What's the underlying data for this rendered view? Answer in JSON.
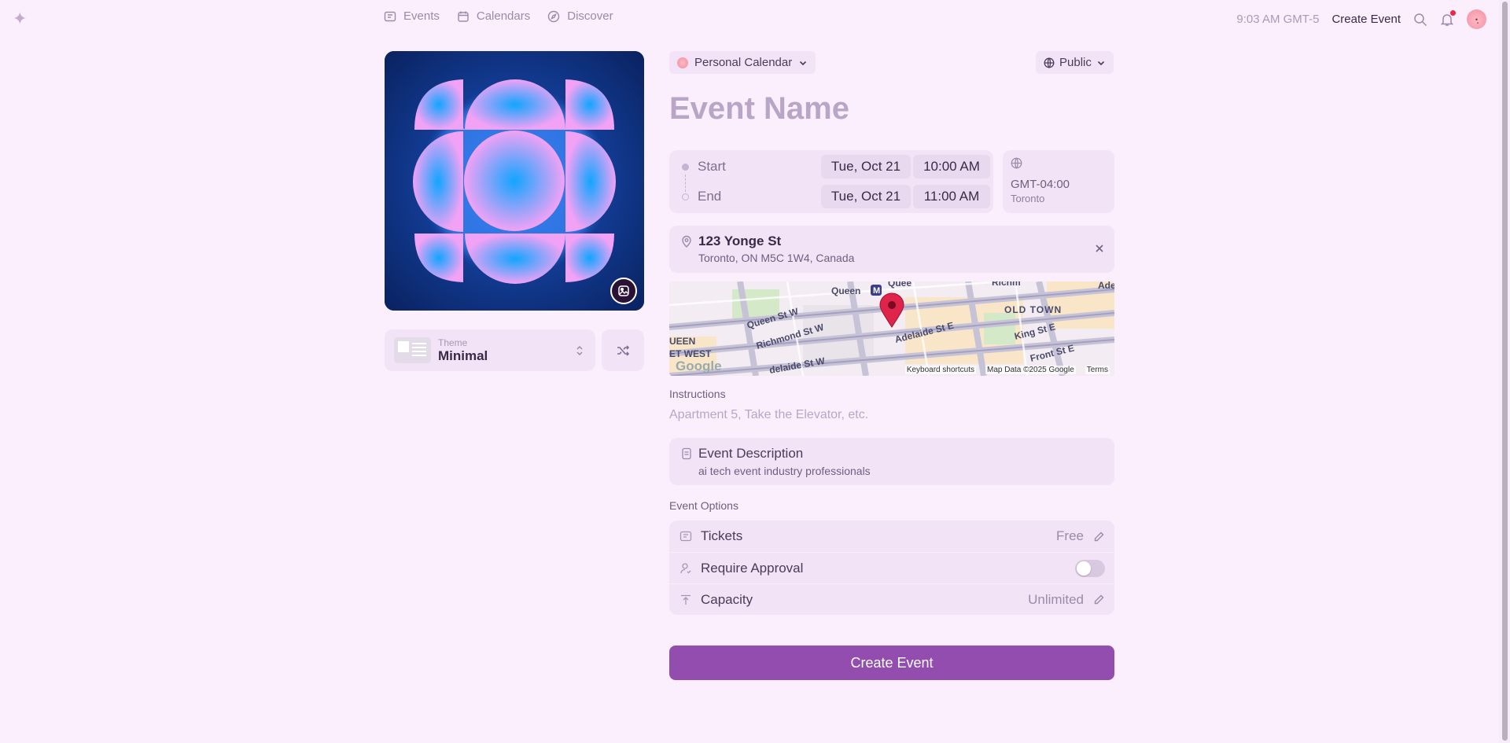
{
  "nav": {
    "logo_icon": "sparkle-icon",
    "items": [
      {
        "label": "Events",
        "icon": "ticket-icon"
      },
      {
        "label": "Calendars",
        "icon": "calendar-icon"
      },
      {
        "label": "Discover",
        "icon": "compass-icon"
      }
    ],
    "time": "9:03 AM GMT-5",
    "create_event": "Create Event",
    "notification_color": "#e8294a"
  },
  "cover": {
    "colors": {
      "background": "#0b2a6a",
      "pink": "#f2a2f5",
      "cyan": "#12a5ff"
    }
  },
  "theme": {
    "label": "Theme",
    "value": "Minimal"
  },
  "calendar": {
    "label": "Personal Calendar"
  },
  "visibility": {
    "label": "Public"
  },
  "event_name": {
    "placeholder": "Event Name"
  },
  "datetime": {
    "start": {
      "label": "Start",
      "date": "Tue, Oct 21",
      "time": "10:00 AM"
    },
    "end": {
      "label": "End",
      "date": "Tue, Oct 21",
      "time": "11:00 AM"
    }
  },
  "timezone": {
    "offset": "GMT-04:00",
    "city": "Toronto"
  },
  "location": {
    "title": "123 Yonge St",
    "address": "Toronto, ON M5C 1W4, Canada"
  },
  "map": {
    "labels": {
      "queen": "Queen",
      "queen2": "Quee",
      "richmond": "Richm",
      "ade": "Ade",
      "old_town": "OLD TOWN",
      "queen_st_w": "Queen St W",
      "richmond_st_w": "Richmond St W",
      "adelaide_st_e": "Adelaide St E",
      "king_st_e": "King St E",
      "queen_w": "UEEN",
      "et_west": "ET WEST",
      "adelaide_st_w": "delaide St W",
      "front_st_e": "Front St E",
      "google": "Google",
      "metro": "M"
    },
    "footer": {
      "shortcuts": "Keyboard shortcuts",
      "data": "Map Data ©2025 Google",
      "terms": "Terms"
    },
    "pin_color": "#e0234b"
  },
  "instructions": {
    "label": "Instructions",
    "placeholder": "Apartment 5, Take the Elevator, etc."
  },
  "description": {
    "title": "Event Description",
    "text": "ai tech event industry professionals"
  },
  "options": {
    "label": "Event Options",
    "tickets": {
      "label": "Tickets",
      "value": "Free"
    },
    "approval": {
      "label": "Require Approval",
      "enabled": false
    },
    "capacity": {
      "label": "Capacity",
      "value": "Unlimited"
    }
  },
  "submit": {
    "label": "Create Event",
    "color": "#924daf"
  }
}
